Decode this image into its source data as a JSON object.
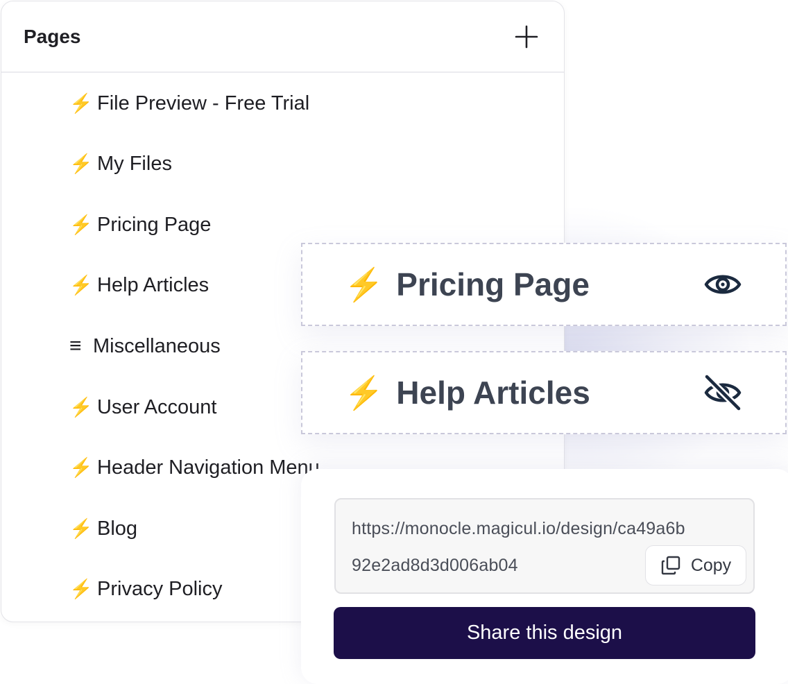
{
  "pages_panel": {
    "title": "Pages",
    "add_icon": "plus-icon",
    "items": [
      {
        "icon": "⚡",
        "label": "File Preview - Free Trial"
      },
      {
        "icon": "⚡",
        "label": "My Files"
      },
      {
        "icon": "⚡",
        "label": "Pricing Page"
      },
      {
        "icon": "⚡",
        "label": "Help Articles"
      },
      {
        "icon": "≡",
        "label": "Miscellaneous"
      },
      {
        "icon": "⚡",
        "label": "User Account"
      },
      {
        "icon": "⚡",
        "label": "Header Navigation Menu"
      },
      {
        "icon": "⚡",
        "label": "Blog"
      },
      {
        "icon": "⚡",
        "label": "Privacy Policy"
      }
    ]
  },
  "drag_cards": [
    {
      "icon": "⚡",
      "label": "Pricing Page",
      "visibility_icon": "eye-icon",
      "visible": true
    },
    {
      "icon": "⚡",
      "label": "Help Articles",
      "visibility_icon": "eye-off-icon",
      "visible": false
    }
  ],
  "share": {
    "url_line1": "https://monocle.magicul.io/design/ca49a6b",
    "url_line2": "92e2ad8d3d006ab04",
    "copy_label": "Copy",
    "button_label": "Share this design"
  },
  "colors": {
    "share_button_bg": "#1c0f49",
    "card_text": "#3d4452",
    "icon_dark": "#1b2a3f",
    "bolt": "#f5b400"
  }
}
